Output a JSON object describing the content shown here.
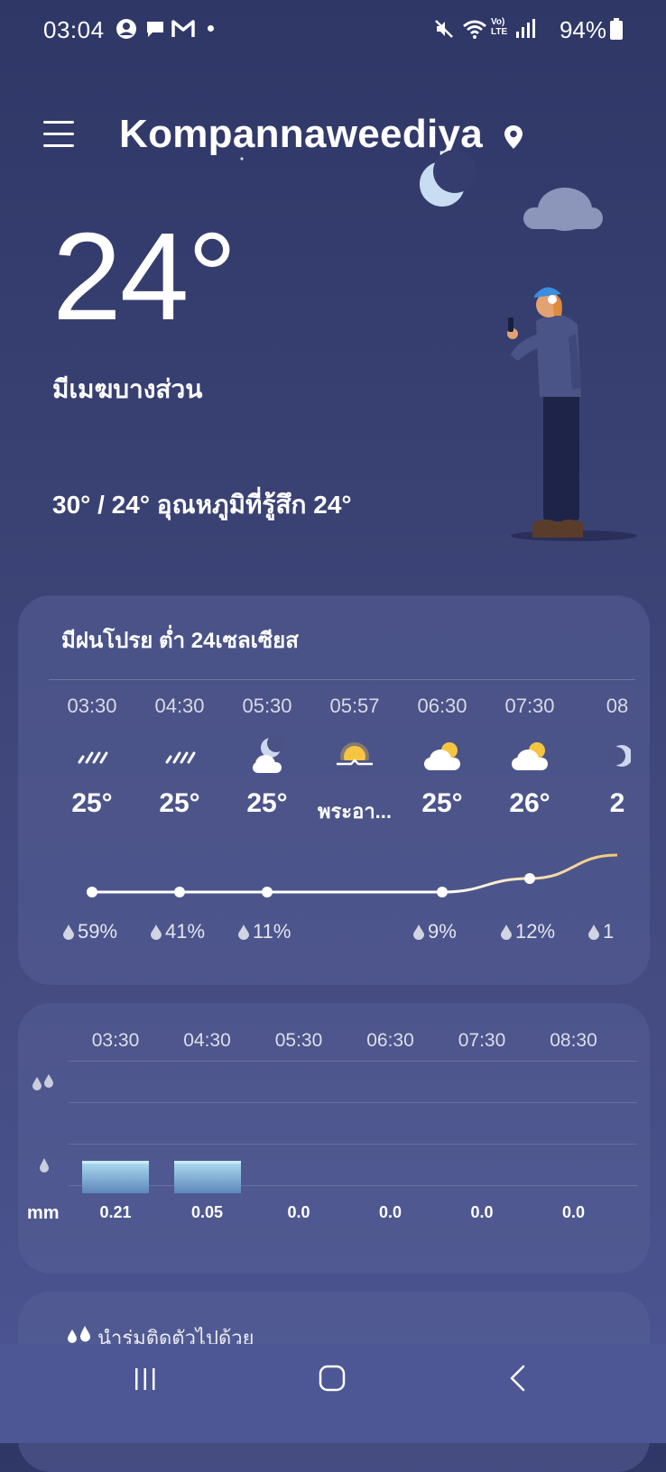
{
  "status_bar": {
    "time": "03:04",
    "battery": "94%"
  },
  "header": {
    "city": "Kompannaweediya"
  },
  "current": {
    "temp": "24°",
    "condition": "มีเมฆบางส่วน",
    "hilo_feels": "30° / 24° อุณหภูมิที่รู้สึก 24°"
  },
  "hourly_card": {
    "summary": "มีฝนโปรย ต่ำ 24เซลเซียส",
    "hours": [
      {
        "time": "03:30",
        "icon": "drizzle-icon",
        "temp": "25°",
        "rain": "59%"
      },
      {
        "time": "04:30",
        "icon": "drizzle-icon",
        "temp": "25°",
        "rain": "41%"
      },
      {
        "time": "05:30",
        "icon": "moon-cloud-icon",
        "temp": "25°",
        "rain": "11%"
      },
      {
        "time": "05:57",
        "icon": "sunrise-icon",
        "temp": "พระอา...",
        "rain": ""
      },
      {
        "time": "06:30",
        "icon": "sun-cloud-icon",
        "temp": "25°",
        "rain": "9%"
      },
      {
        "time": "07:30",
        "icon": "sun-cloud-icon",
        "temp": "26°",
        "rain": "12%"
      },
      {
        "time": "08",
        "icon": "moon-icon",
        "temp": "2",
        "rain": "1"
      }
    ]
  },
  "precip_card": {
    "times": [
      "03:30",
      "04:30",
      "05:30",
      "06:30",
      "07:30",
      "08:30"
    ],
    "values": [
      "0.21",
      "0.05",
      "0.0",
      "0.0",
      "0.0",
      "0.0"
    ],
    "amounts": [
      0.21,
      0.05,
      0,
      0,
      0,
      0
    ],
    "unit": "mm"
  },
  "advice_card": {
    "text": "นำร่มติดตัวไปด้วย"
  },
  "colors": {
    "background_top": "#2f3767",
    "background_bottom": "#4d5694",
    "card": "#565e96",
    "sun": "#f5c542"
  }
}
